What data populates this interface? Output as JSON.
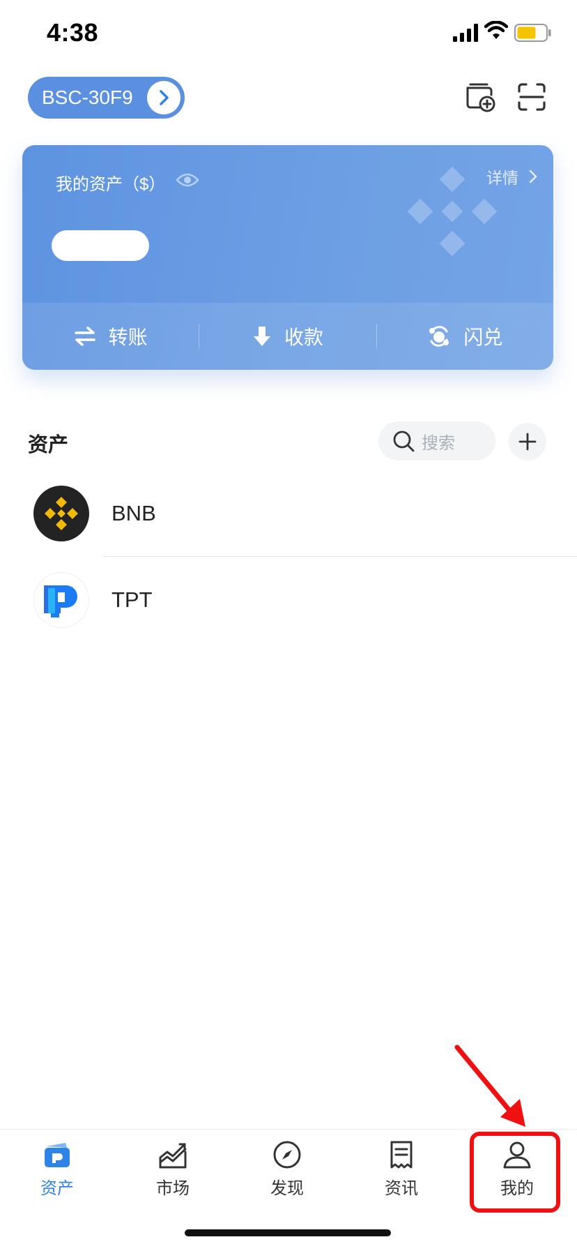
{
  "status_bar": {
    "time": "4:38"
  },
  "header": {
    "wallet_name": "BSC-30F9"
  },
  "asset_card": {
    "label": "我的资产（$）",
    "detail": "详情",
    "actions": {
      "transfer": "转账",
      "receive": "收款",
      "swap": "闪兑"
    }
  },
  "assets": {
    "title": "资产",
    "search_placeholder": "搜索",
    "tokens": [
      {
        "symbol": "BNB",
        "icon": "bnb-logo"
      },
      {
        "symbol": "TPT",
        "icon": "tpt-logo"
      }
    ]
  },
  "tab_bar": {
    "tabs": [
      {
        "label": "资产",
        "icon": "wallet-icon",
        "active": true
      },
      {
        "label": "市场",
        "icon": "chart-icon"
      },
      {
        "label": "发现",
        "icon": "compass-icon"
      },
      {
        "label": "资讯",
        "icon": "news-icon"
      },
      {
        "label": "我的",
        "icon": "profile-icon"
      }
    ]
  },
  "colors": {
    "accent": "#2d83e6",
    "card": "#6a9ce3",
    "annotation": "#ef1111",
    "bnb_yellow": "#f0b90b"
  }
}
